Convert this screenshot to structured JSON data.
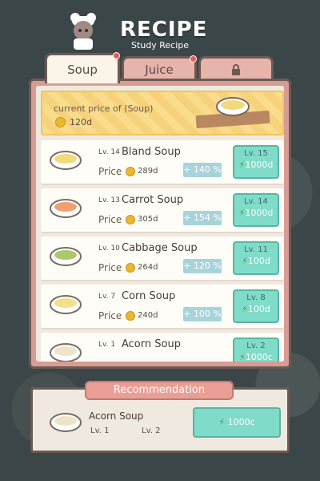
{
  "header": {
    "title": "RECIPE",
    "subtitle": "Study Recipe"
  },
  "tabs": [
    {
      "label": "Soup",
      "active": true,
      "has_dot": true
    },
    {
      "label": "Juice",
      "active": false,
      "has_dot": true
    },
    {
      "label": "",
      "icon": "lock-icon",
      "active": false
    }
  ],
  "price_banner": {
    "label": "current price of (Soup)",
    "value": "120d"
  },
  "recipes": [
    {
      "level": "Lv. 14",
      "name": "Bland Soup",
      "price_label": "Price",
      "price": "289d",
      "bonus": "+ 140 %",
      "next_level": "Lv. 15",
      "cost": "1000d",
      "bowl_color": "#f2d97a"
    },
    {
      "level": "Lv. 13",
      "name": "Carrot Soup",
      "price_label": "Price",
      "price": "305d",
      "bonus": "+ 154 %",
      "next_level": "Lv. 14",
      "cost": "1000d",
      "bowl_color": "#f0a070"
    },
    {
      "level": "Lv. 10",
      "name": "Cabbage Soup",
      "price_label": "Price",
      "price": "264d",
      "bonus": "+ 120 %",
      "next_level": "Lv. 11",
      "cost": "100d",
      "bowl_color": "#a9c96a"
    },
    {
      "level": "Lv. 7",
      "name": "Corn Soup",
      "price_label": "Price",
      "price": "240d",
      "bonus": "+ 100 %",
      "next_level": "Lv. 8",
      "cost": "100d",
      "bowl_color": "#f3e08a"
    },
    {
      "level": "Lv. 1",
      "name": "Acorn Soup",
      "price_label": "",
      "price": "",
      "bonus": "",
      "next_level": "Lv. 2",
      "cost": "1000c",
      "bowl_color": "#efe4c8"
    }
  ],
  "recommendation": {
    "title": "Recommendation",
    "name": "Acorn Soup",
    "level_from": "Lv. 1",
    "level_to": "Lv. 2",
    "cost": "1000c"
  },
  "colors": {
    "accent_teal": "#80dbc8",
    "tab_pink": "#e7b4ab",
    "bonus_blue": "#a7d4da",
    "coin_gold": "#e8b830"
  }
}
